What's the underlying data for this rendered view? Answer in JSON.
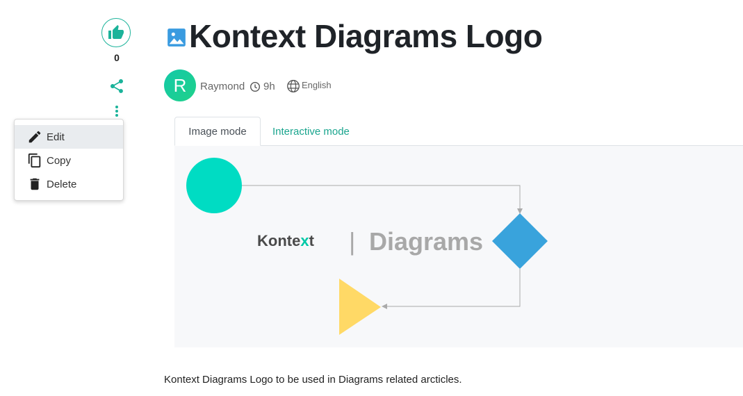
{
  "rail": {
    "like_count": "0",
    "icons": {
      "like": "thumbs-up-icon",
      "share": "share-icon",
      "more": "more-vertical-icon"
    },
    "accent_color": "#1bb39a"
  },
  "menu": {
    "items": [
      {
        "label": "Edit",
        "icon": "pencil-icon"
      },
      {
        "label": "Copy",
        "icon": "copy-icon"
      },
      {
        "label": "Delete",
        "icon": "trash-icon"
      }
    ]
  },
  "header": {
    "title": "Kontext Diagrams Logo",
    "title_icon": "image-icon",
    "avatar_initial": "R",
    "author": "Raymond",
    "time": "9h",
    "language": "English"
  },
  "tabs": [
    {
      "label": "Image mode",
      "active": true
    },
    {
      "label": "Interactive mode",
      "active": false
    }
  ],
  "diagram": {
    "logo_text_dark": "Konte",
    "logo_text_accent": "x",
    "logo_text_end": "t",
    "separator": "|",
    "word": "Diagrams",
    "colors": {
      "circle": "#00dcc3",
      "diamond": "#39a3dc",
      "triangle": "#ffd966",
      "accent": "#00c9a7"
    }
  },
  "description": "Kontext Diagrams Logo to be used in Diagrams related arcticles."
}
